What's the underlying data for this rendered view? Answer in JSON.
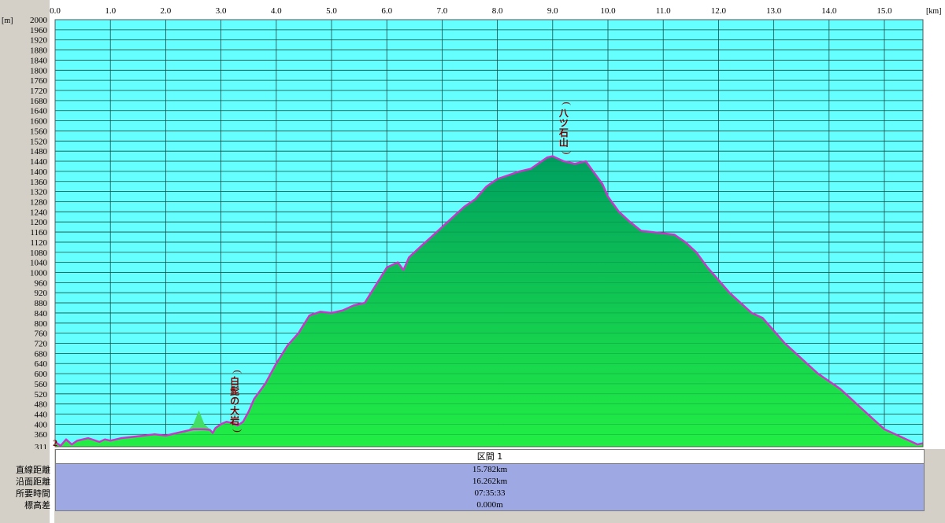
{
  "chart_data": {
    "type": "area",
    "xlabel_unit": "[km]",
    "ylabel_unit": "[m]",
    "xlim": [
      0,
      15.782
    ],
    "ylim": [
      311,
      2000
    ],
    "x_ticks": [
      "0.0",
      "1.0",
      "2.0",
      "3.0",
      "4.0",
      "5.0",
      "6.0",
      "7.0",
      "8.0",
      "9.0",
      "10.0",
      "11.0",
      "12.0",
      "13.0",
      "14.0",
      "15.0"
    ],
    "y_ticks": [
      311,
      360,
      400,
      440,
      480,
      520,
      560,
      600,
      640,
      680,
      720,
      760,
      800,
      840,
      880,
      920,
      960,
      1000,
      1040,
      1080,
      1120,
      1160,
      1200,
      1240,
      1280,
      1320,
      1360,
      1400,
      1440,
      1480,
      1520,
      1560,
      1600,
      1640,
      1680,
      1720,
      1760,
      1800,
      1840,
      1880,
      1920,
      1960,
      2000
    ],
    "grid": true,
    "series": [
      {
        "x": [
          0.0,
          0.1,
          0.2,
          0.3,
          0.4,
          0.6,
          0.8,
          0.9,
          1.0,
          1.2,
          1.4,
          1.6,
          1.8,
          2.0,
          2.2,
          2.4,
          2.5,
          2.6,
          2.7,
          2.8,
          2.85,
          2.9,
          3.0,
          3.1,
          3.2,
          3.3,
          3.4,
          3.5,
          3.6,
          3.8,
          4.0,
          4.2,
          4.4,
          4.6,
          4.8,
          5.0,
          5.2,
          5.4,
          5.6,
          5.8,
          6.0,
          6.1,
          6.2,
          6.3,
          6.4,
          6.5,
          6.6,
          6.7,
          6.8,
          7.0,
          7.2,
          7.4,
          7.6,
          7.8,
          8.0,
          8.2,
          8.4,
          8.6,
          8.8,
          8.9,
          9.0,
          9.1,
          9.2,
          9.3,
          9.4,
          9.5,
          9.6,
          9.7,
          9.8,
          9.9,
          10.0,
          10.2,
          10.4,
          10.6,
          10.8,
          11.0,
          11.2,
          11.4,
          11.6,
          11.8,
          12.0,
          12.2,
          12.4,
          12.6,
          12.8,
          13.0,
          13.2,
          13.4,
          13.6,
          13.8,
          14.0,
          14.2,
          14.4,
          14.6,
          14.8,
          15.0,
          15.2,
          15.4,
          15.5,
          15.6,
          15.7,
          15.782
        ],
        "y": [
          330,
          315,
          340,
          320,
          335,
          345,
          330,
          340,
          335,
          345,
          350,
          355,
          360,
          355,
          365,
          375,
          380,
          380,
          380,
          378,
          365,
          385,
          400,
          410,
          405,
          395,
          410,
          450,
          500,
          560,
          640,
          710,
          760,
          830,
          845,
          840,
          850,
          870,
          880,
          950,
          1020,
          1030,
          1040,
          1010,
          1060,
          1080,
          1100,
          1120,
          1140,
          1180,
          1220,
          1260,
          1290,
          1340,
          1370,
          1385,
          1400,
          1410,
          1440,
          1455,
          1460,
          1450,
          1440,
          1435,
          1430,
          1435,
          1440,
          1410,
          1380,
          1350,
          1300,
          1240,
          1200,
          1165,
          1160,
          1155,
          1150,
          1120,
          1080,
          1020,
          970,
          920,
          880,
          840,
          820,
          770,
          720,
          680,
          640,
          600,
          570,
          540,
          500,
          460,
          420,
          380,
          360,
          340,
          330,
          320,
          325,
          330
        ]
      }
    ],
    "bump": {
      "x": [
        2.35,
        2.5,
        2.6,
        2.7,
        2.8
      ],
      "y": [
        362,
        400,
        455,
        400,
        380
      ]
    },
    "annotations": [
      {
        "text": "(白髭の大岩)",
        "x": 3.25,
        "y": 490
      },
      {
        "text": "(八ツ石山)",
        "x": 9.2,
        "y": 1570
      }
    ],
    "start_marker": "2",
    "colors": {
      "background": "#66ffff",
      "fill_top": "#00a060",
      "fill_bottom": "#22ee44",
      "line": "#cc33cc",
      "grid": "#1a4a4a",
      "annotation": "#800000"
    }
  },
  "summary": {
    "header": "区間 1",
    "rows": [
      {
        "label": "直線距離",
        "value": "15.782km"
      },
      {
        "label": "沿面距離",
        "value": "16.262km"
      },
      {
        "label": "所要時間",
        "value": "07:35:33"
      },
      {
        "label": "標高差",
        "value": "0.000m"
      }
    ]
  }
}
